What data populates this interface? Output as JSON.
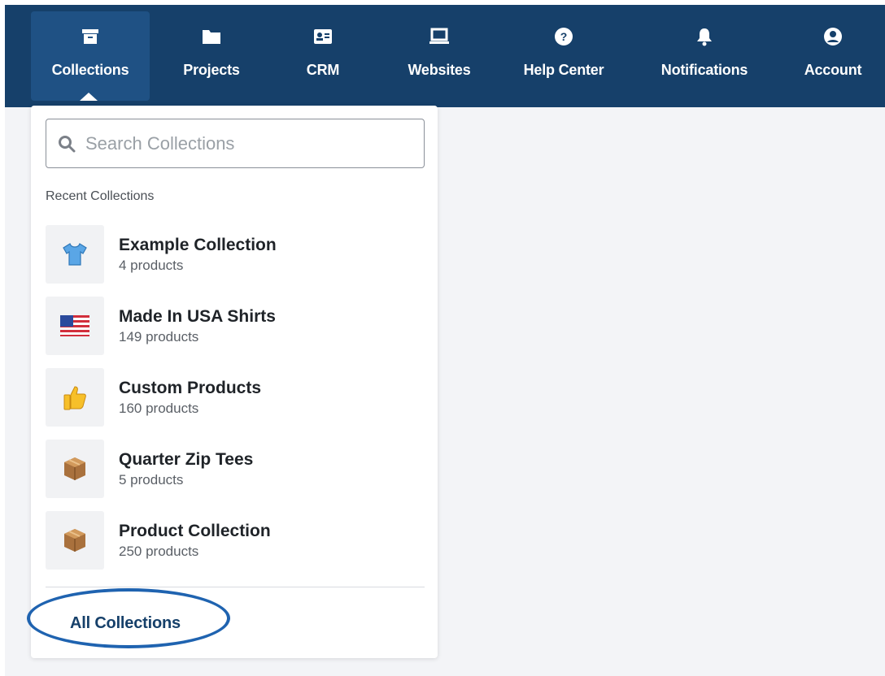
{
  "nav": {
    "items": [
      {
        "label": "Collections",
        "icon": "archive-icon"
      },
      {
        "label": "Projects",
        "icon": "folder-icon"
      },
      {
        "label": "CRM",
        "icon": "contact-card-icon"
      },
      {
        "label": "Websites",
        "icon": "laptop-icon"
      },
      {
        "label": "Help Center",
        "icon": "help-circle-icon"
      },
      {
        "label": "Notifications",
        "icon": "bell-icon"
      },
      {
        "label": "Account",
        "icon": "user-circle-icon"
      }
    ],
    "active": "Collections"
  },
  "dropdown": {
    "search_placeholder": "Search Collections",
    "section_label": "Recent Collections",
    "items": [
      {
        "title": "Example Collection",
        "subtitle": "4 products",
        "icon": "shirt-emoji"
      },
      {
        "title": "Made In USA Shirts",
        "subtitle": "149 products",
        "icon": "us-flag-emoji"
      },
      {
        "title": "Custom Products",
        "subtitle": "160 products",
        "icon": "thumbs-up-emoji"
      },
      {
        "title": "Quarter Zip Tees",
        "subtitle": "5 products",
        "icon": "package-emoji"
      },
      {
        "title": "Product Collection",
        "subtitle": "250 products",
        "icon": "package-emoji"
      }
    ],
    "all_link": "All Collections"
  },
  "colors": {
    "navbar": "#16406a",
    "nav_active": "#1f5184",
    "highlight": "#1f63b0",
    "page_bg": "#f3f4f7"
  }
}
